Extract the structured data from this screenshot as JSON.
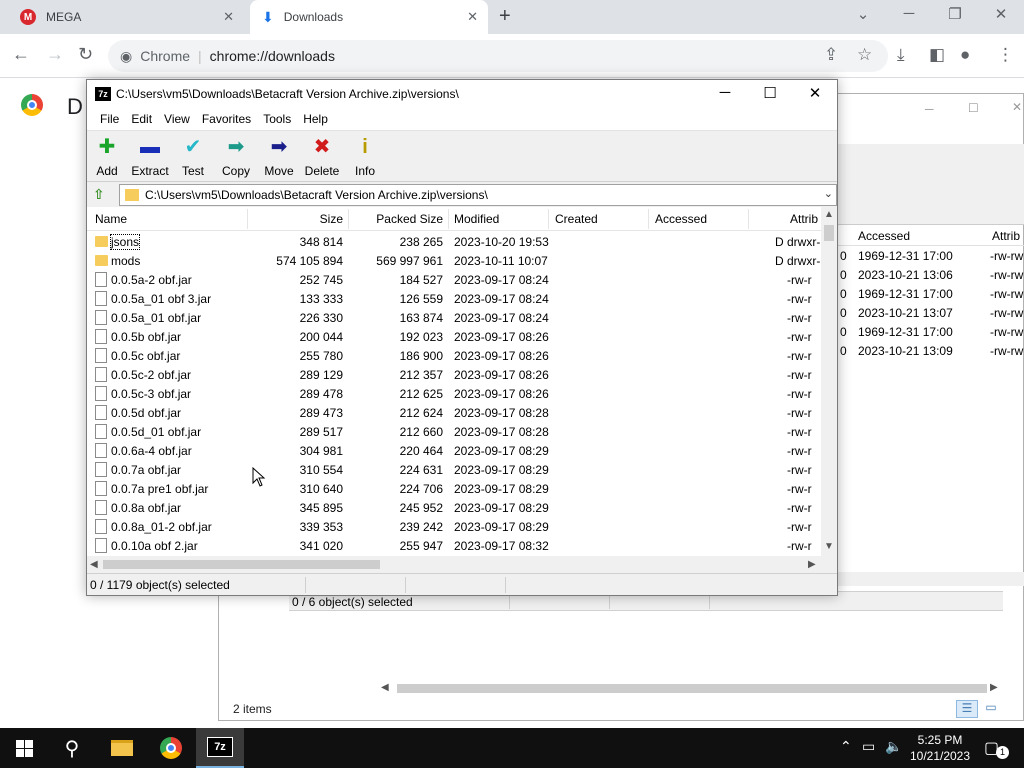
{
  "chrome": {
    "tabs": [
      {
        "title": "MEGA",
        "close": "✕"
      },
      {
        "title": "Downloads",
        "close": "✕"
      }
    ],
    "new_tab": "+",
    "omnibox": {
      "site_chip": "Chrome",
      "url": "chrome://downloads"
    },
    "page_heading": "D",
    "icons": {
      "back": "back-arrow-icon",
      "forward": "forward-arrow-icon",
      "reload": "reload-icon",
      "share": "share-icon",
      "bookmark": "star-icon",
      "download": "download-icon",
      "side_panel": "side-panel-icon",
      "profile": "profile-icon",
      "menu": "kebab-menu-icon"
    }
  },
  "background_window": {
    "column_headers": {
      "accessed": "Accessed",
      "attrib": "Attrib"
    },
    "rows": [
      {
        "prefix": "0",
        "accessed": "1969-12-31 17:00",
        "attrib": "-rw-rw"
      },
      {
        "prefix": "0",
        "accessed": "2023-10-21 13:06",
        "attrib": "-rw-rw"
      },
      {
        "prefix": "0",
        "accessed": "1969-12-31 17:00",
        "attrib": "-rw-rw"
      },
      {
        "prefix": "0",
        "accessed": "2023-10-21 13:07",
        "attrib": "-rw-rw"
      },
      {
        "prefix": "0",
        "accessed": "1969-12-31 17:00",
        "attrib": "-rw-rw"
      },
      {
        "prefix": "0",
        "accessed": "2023-10-21 13:09",
        "attrib": "-rw-rw"
      }
    ],
    "status": "0 / 6 object(s) selected",
    "footer": "2 items"
  },
  "sevenzip": {
    "title": "C:\\Users\\vm5\\Downloads\\Betacraft Version Archive.zip\\versions\\",
    "app_icon": "7z",
    "menu": [
      "File",
      "Edit",
      "View",
      "Favorites",
      "Tools",
      "Help"
    ],
    "toolbar": [
      {
        "label": "Add",
        "glyph": "✚",
        "color": "#1aa52a",
        "icon": "add-icon"
      },
      {
        "label": "Extract",
        "glyph": "▬",
        "color": "#1a2fb8",
        "icon": "extract-icon"
      },
      {
        "label": "Test",
        "glyph": "✔",
        "color": "#26b8c9",
        "icon": "test-icon"
      },
      {
        "label": "Copy",
        "glyph": "➡",
        "color": "#1e9a8a",
        "icon": "copy-icon"
      },
      {
        "label": "Move",
        "glyph": "➡",
        "color": "#1a1f8c",
        "icon": "move-icon"
      },
      {
        "label": "Delete",
        "glyph": "✖",
        "color": "#d11a1a",
        "icon": "delete-icon"
      },
      {
        "label": "Info",
        "glyph": "i",
        "color": "#b89b00",
        "icon": "info-icon"
      }
    ],
    "path": "C:\\Users\\vm5\\Downloads\\Betacraft Version Archive.zip\\versions\\",
    "columns": [
      "Name",
      "Size",
      "Packed Size",
      "Modified",
      "Created",
      "Accessed",
      "Attrib"
    ],
    "rows": [
      {
        "type": "folder",
        "name": "jsons",
        "size": "348 814",
        "packed": "238 265",
        "modified": "2023-10-20 19:53",
        "attrib": "D drwxr-"
      },
      {
        "type": "folder",
        "name": "mods",
        "size": "574 105 894",
        "packed": "569 997 961",
        "modified": "2023-10-11 10:07",
        "attrib": "D drwxr-"
      },
      {
        "type": "file",
        "name": "0.0.5a-2 obf.jar",
        "size": "252 745",
        "packed": "184 527",
        "modified": "2023-09-17 08:24",
        "attrib": "-rw-r"
      },
      {
        "type": "file",
        "name": "0.0.5a_01 obf 3.jar",
        "size": "133 333",
        "packed": "126 559",
        "modified": "2023-09-17 08:24",
        "attrib": "-rw-r"
      },
      {
        "type": "file",
        "name": "0.0.5a_01 obf.jar",
        "size": "226 330",
        "packed": "163 874",
        "modified": "2023-09-17 08:24",
        "attrib": "-rw-r"
      },
      {
        "type": "file",
        "name": "0.0.5b obf.jar",
        "size": "200 044",
        "packed": "192 023",
        "modified": "2023-09-17 08:26",
        "attrib": "-rw-r"
      },
      {
        "type": "file",
        "name": "0.0.5c obf.jar",
        "size": "255 780",
        "packed": "186 900",
        "modified": "2023-09-17 08:26",
        "attrib": "-rw-r"
      },
      {
        "type": "file",
        "name": "0.0.5c-2 obf.jar",
        "size": "289 129",
        "packed": "212 357",
        "modified": "2023-09-17 08:26",
        "attrib": "-rw-r"
      },
      {
        "type": "file",
        "name": "0.0.5c-3 obf.jar",
        "size": "289 478",
        "packed": "212 625",
        "modified": "2023-09-17 08:26",
        "attrib": "-rw-r"
      },
      {
        "type": "file",
        "name": "0.0.5d obf.jar",
        "size": "289 473",
        "packed": "212 624",
        "modified": "2023-09-17 08:28",
        "attrib": "-rw-r"
      },
      {
        "type": "file",
        "name": "0.0.5d_01 obf.jar",
        "size": "289 517",
        "packed": "212 660",
        "modified": "2023-09-17 08:28",
        "attrib": "-rw-r"
      },
      {
        "type": "file",
        "name": "0.0.6a-4 obf.jar",
        "size": "304 981",
        "packed": "220 464",
        "modified": "2023-09-17 08:29",
        "attrib": "-rw-r"
      },
      {
        "type": "file",
        "name": "0.0.7a obf.jar",
        "size": "310 554",
        "packed": "224 631",
        "modified": "2023-09-17 08:29",
        "attrib": "-rw-r"
      },
      {
        "type": "file",
        "name": "0.0.7a pre1 obf.jar",
        "size": "310 640",
        "packed": "224 706",
        "modified": "2023-09-17 08:29",
        "attrib": "-rw-r"
      },
      {
        "type": "file",
        "name": "0.0.8a obf.jar",
        "size": "345 895",
        "packed": "245 952",
        "modified": "2023-09-17 08:29",
        "attrib": "-rw-r"
      },
      {
        "type": "file",
        "name": "0.0.8a_01-2 obf.jar",
        "size": "339 353",
        "packed": "239 242",
        "modified": "2023-09-17 08:29",
        "attrib": "-rw-r"
      },
      {
        "type": "file",
        "name": "0.0.10a obf 2.jar",
        "size": "341 020",
        "packed": "255 947",
        "modified": "2023-09-17 08:32",
        "attrib": "-rw-r"
      }
    ],
    "status": "0 / 1179 object(s) selected"
  },
  "taskbar": {
    "apps": [
      "start-button",
      "search-icon",
      "file-explorer-icon",
      "chrome-icon",
      "7zip-icon"
    ],
    "time": "5:25 PM",
    "date": "10/21/2023",
    "notifications": "1"
  }
}
